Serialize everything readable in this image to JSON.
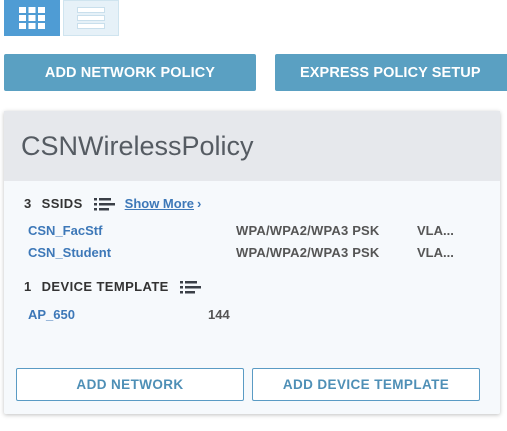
{
  "toolbar": {
    "add_policy_label": "ADD NETWORK POLICY",
    "express_label": "EXPRESS POLICY SETUP"
  },
  "view_toggle": {
    "grid_icon": "grid-icon",
    "list_icon": "list-icon",
    "active": "grid"
  },
  "policy_card": {
    "title": "CSNWirelessPolicy",
    "ssids": {
      "count": "3",
      "label": "SSIDS",
      "show_more": "Show More",
      "items": [
        {
          "name": "CSN_FacStf",
          "security": "WPA/WPA2/WPA3 PSK",
          "vlan": "VLA..."
        },
        {
          "name": "CSN_Student",
          "security": "WPA/WPA2/WPA3 PSK",
          "vlan": "VLA..."
        }
      ]
    },
    "device_templates": {
      "count": "1",
      "label": "DEVICE TEMPLATE",
      "items": [
        {
          "name": "AP_650",
          "count": "144"
        }
      ]
    },
    "add_network_label": "ADD NETWORK",
    "add_device_template_label": "ADD DEVICE TEMPLATE"
  },
  "colors": {
    "accent": "#4f9cd4",
    "button_bg": "#5aa0c2",
    "link": "#3d78b8",
    "card_header": "#e6e8ec"
  }
}
